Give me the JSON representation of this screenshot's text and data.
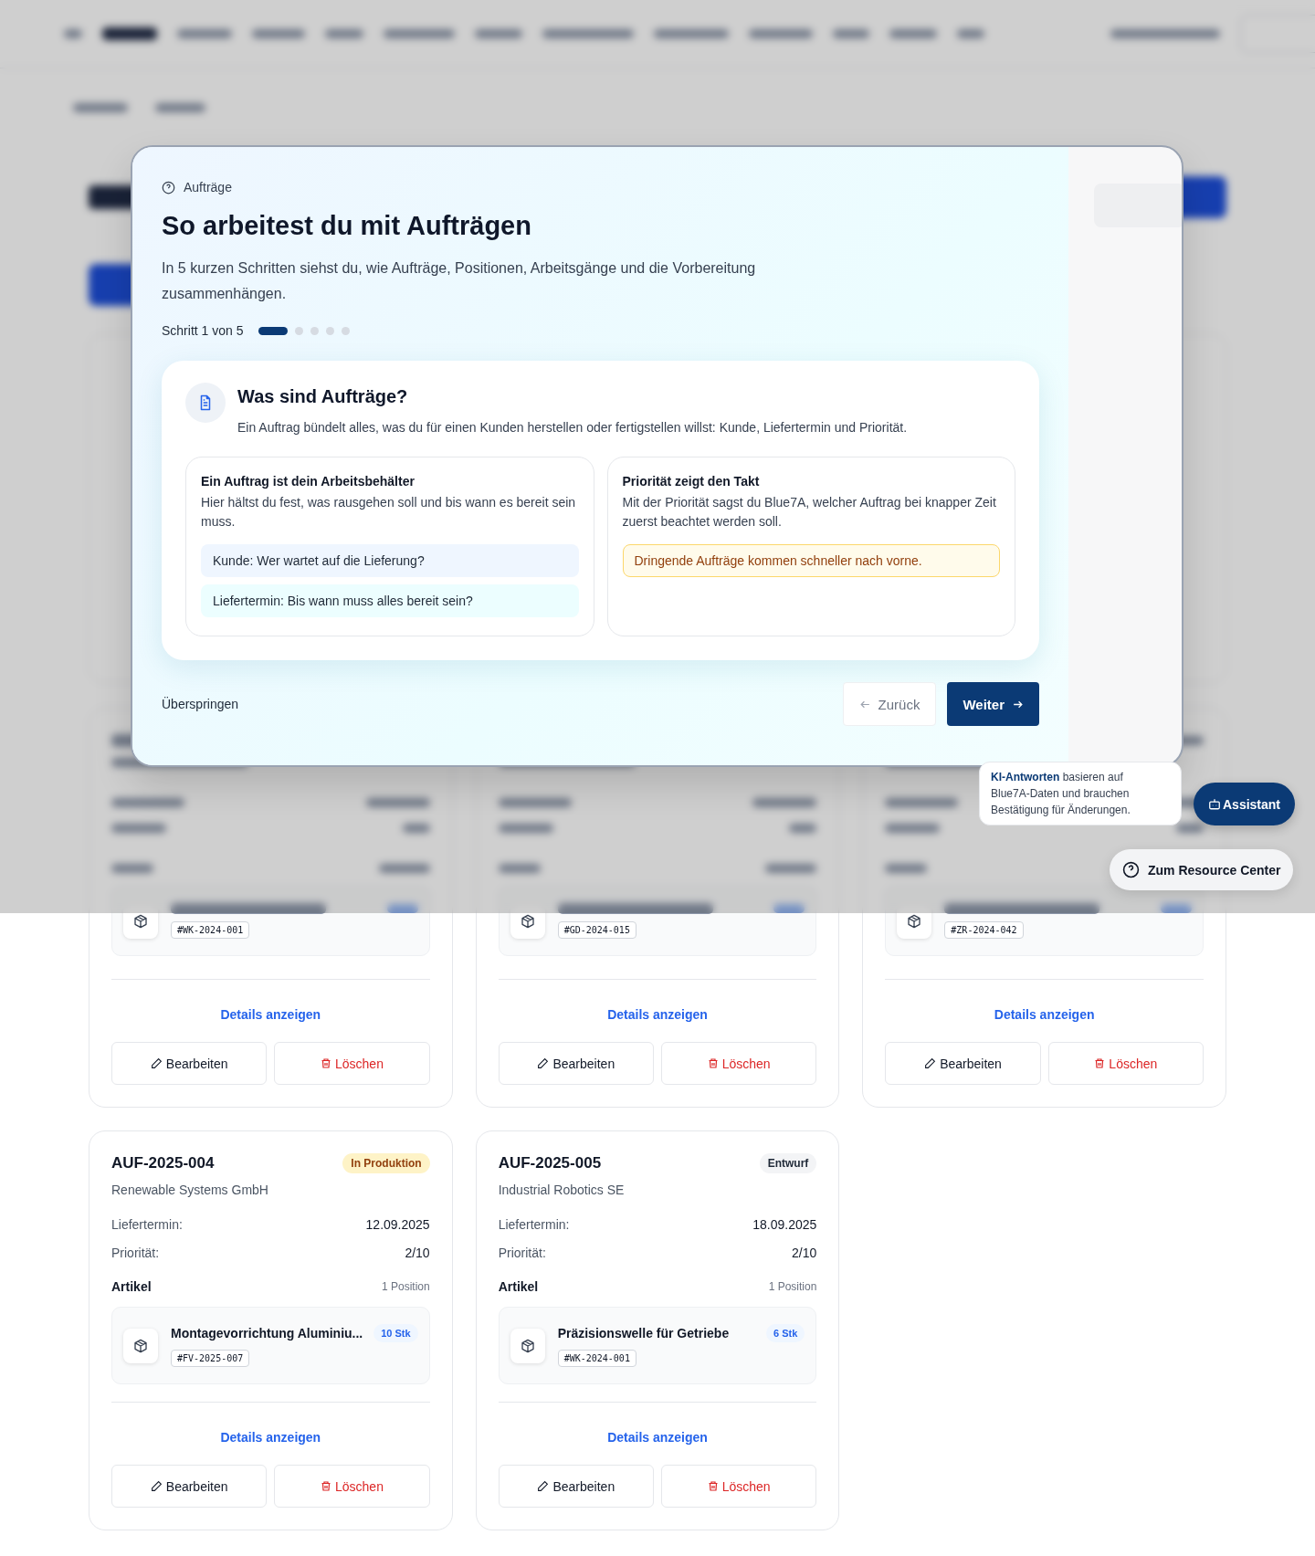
{
  "modal": {
    "eyebrow": "Aufträge",
    "title": "So arbeitest du mit Aufträgen",
    "intro": "In 5 kurzen Schritten siehst du, wie Aufträge, Positionen, Arbeitsgänge und die Vorbereitung zusammenhängen.",
    "step_label": "Schritt 1 von 5",
    "steps": [
      {
        "selected": true
      },
      {
        "selected": false
      },
      {
        "selected": false
      },
      {
        "selected": false
      },
      {
        "selected": false
      }
    ],
    "card": {
      "title": "Was sind Aufträge?",
      "text": "Ein Auftrag bündelt alles, was du für einen Kunden herstellen oder fertigstellen willst: Kunde, Liefertermin und Priorität.",
      "panels": [
        {
          "title": "Ein Auftrag ist dein Arbeitsbehälter",
          "text": "Hier hältst du fest, was rausgehen soll und bis wann es bereit sein muss.",
          "notes": [
            {
              "text": "Kunde: Wer wartet auf die Lieferung?",
              "kind": "info"
            },
            {
              "text": "Liefertermin: Bis wann muss alles bereit sein?",
              "kind": "teal"
            }
          ]
        },
        {
          "title": "Priorität zeigt den Takt",
          "text": "Mit der Priorität sagst du Blue7A, welcher Auftrag bei knapper Zeit zuerst beachtet werden soll.",
          "notes": [
            {
              "text": "Dringende Aufträge kommen schneller nach vorne.",
              "kind": "warning"
            }
          ]
        }
      ]
    },
    "skip": "Überspringen",
    "back": "Zurück",
    "next": "Weiter"
  },
  "assistant": {
    "hint": "**KI-Antworten** basieren auf Blue7A-Daten und brauchen Bestätigung für Änderungen.",
    "button": "Assistant",
    "resource_center": "Zum Resource Center"
  },
  "orders": [
    {
      "obscured": true,
      "items": [
        {
          "code": "#WK-2024-001"
        }
      ],
      "details": "Details anzeigen",
      "edit": "Bearbeiten",
      "delete": "Löschen"
    },
    {
      "obscured": true,
      "items": [
        {
          "code": "#GD-2024-015"
        }
      ],
      "details": "Details anzeigen",
      "edit": "Bearbeiten",
      "delete": "Löschen"
    },
    {
      "obscured": true,
      "items": [
        {
          "code": "#ZR-2024-042"
        }
      ],
      "details": "Details anzeigen",
      "edit": "Bearbeiten",
      "delete": "Löschen"
    },
    {
      "obscured": false,
      "number": "AUF-2025-004",
      "status": {
        "label": "In Produktion",
        "kind": "production"
      },
      "customer": "Renewable Systems GmbH",
      "fields": [
        {
          "label": "Liefertermin:",
          "value": "12.09.2025"
        },
        {
          "label": "Priorität:",
          "value": "2/10"
        }
      ],
      "items_title": "Artikel",
      "items_count": "1 Position",
      "items": [
        {
          "name": "Montagevorrichtung Aluminiu...",
          "quantity": "10 Stk",
          "code": "#FV-2025-007"
        }
      ],
      "details": "Details anzeigen",
      "edit": "Bearbeiten",
      "delete": "Löschen"
    },
    {
      "obscured": false,
      "number": "AUF-2025-005",
      "status": {
        "label": "Entwurf",
        "kind": "draft"
      },
      "customer": "Industrial Robotics SE",
      "fields": [
        {
          "label": "Liefertermin:",
          "value": "18.09.2025"
        },
        {
          "label": "Priorität:",
          "value": "2/10"
        }
      ],
      "items_title": "Artikel",
      "items_count": "1 Position",
      "items": [
        {
          "name": "Präzisionswelle für Getriebe",
          "quantity": "6 Stk",
          "code": "#WK-2024-001"
        }
      ],
      "details": "Details anzeigen",
      "edit": "Bearbeiten",
      "delete": "Löschen"
    }
  ]
}
